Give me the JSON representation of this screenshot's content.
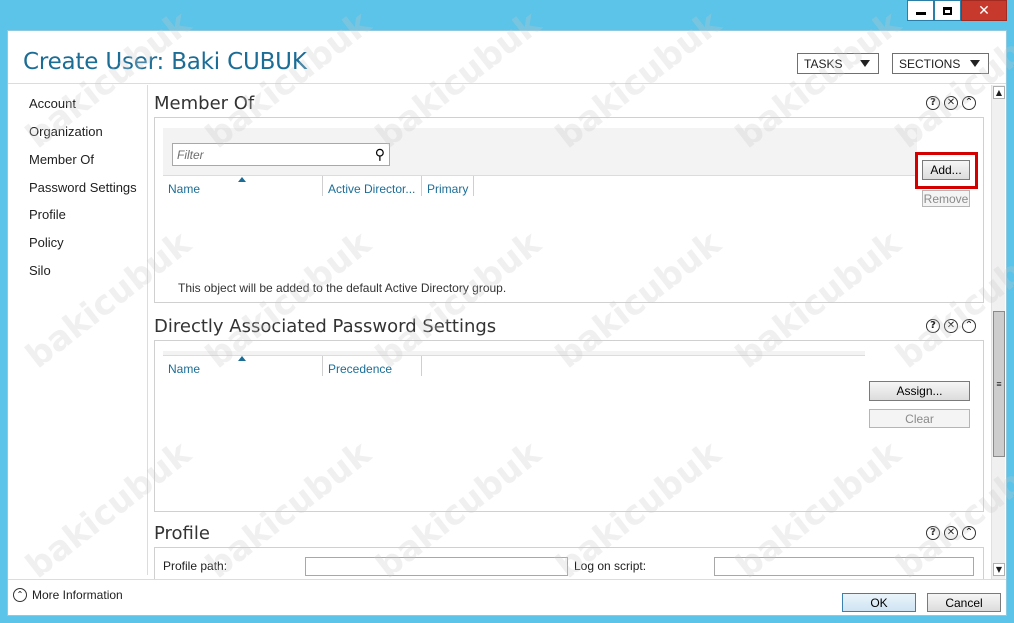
{
  "window": {
    "title": "Create User: Baki CUBUK"
  },
  "header": {
    "tasks_label": "TASKS",
    "sections_label": "SECTIONS"
  },
  "nav": {
    "items": [
      "Account",
      "Organization",
      "Member Of",
      "Password Settings",
      "Profile",
      "Policy",
      "Silo"
    ]
  },
  "member_of": {
    "title": "Member Of",
    "filter_placeholder": "Filter",
    "columns": [
      "Name",
      "Active Director...",
      "Primary"
    ],
    "add_label": "Add...",
    "remove_label": "Remove",
    "note": "This object will be added to the default Active Directory group."
  },
  "password_settings": {
    "title": "Directly Associated Password Settings",
    "columns": [
      "Name",
      "Precedence"
    ],
    "assign_label": "Assign...",
    "clear_label": "Clear"
  },
  "profile": {
    "title": "Profile",
    "profile_path_label": "Profile path:",
    "logon_script_label": "Log on script:"
  },
  "footer": {
    "more_info_label": "More Information",
    "ok_label": "OK",
    "cancel_label": "Cancel"
  },
  "section_icons": [
    "help-icon",
    "close-icon",
    "collapse-icon"
  ],
  "watermark": "bakicubuk",
  "colors": {
    "title_blue": "#1c6d96",
    "frame_blue": "#5bc4e8",
    "highlight_red": "#d40000"
  }
}
